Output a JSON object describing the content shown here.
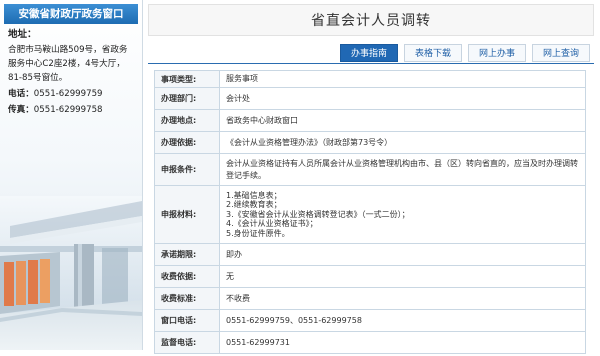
{
  "sidebar": {
    "header": "安徽省财政厅政务窗口",
    "address_label": "地址：",
    "address": "合肥市马鞍山路509号，省政务服务中心C2座2楼，4号大厅，81-85号窗位。",
    "phone_label": "电话：",
    "phone": "0551-62999759",
    "fax_label": "传真：",
    "fax": "0551-62999758"
  },
  "page_title": "省直会计人员调转",
  "tabs": [
    {
      "label": "办事指南",
      "active": true
    },
    {
      "label": "表格下载",
      "active": false
    },
    {
      "label": "网上办事",
      "active": false
    },
    {
      "label": "网上查询",
      "active": false
    }
  ],
  "rows": [
    {
      "key": "事项类型:",
      "value": "服务事项"
    },
    {
      "key": "办理部门:",
      "value": "会计处"
    },
    {
      "key": "办理地点:",
      "value": "省政务中心财政窗口"
    },
    {
      "key": "办理依据:",
      "value": "《会计从业资格管理办法》（财政部第73号令）"
    },
    {
      "key": "申报条件:",
      "value": "会计从业资格证持有人员所属会计从业资格管理机构由市、县（区）转向省直的，应当及时办理调转登记手续。"
    },
    {
      "key": "申报材料:",
      "value_lines": [
        "1.基础信息表；",
        "2.继续教育表；",
        "3.《安徽省会计从业资格调转登记表》（一式二份）；",
        "4.《会计从业资格证书》；",
        "5.身份证件原件。"
      ]
    },
    {
      "key": "承诺期限:",
      "value": "即办"
    },
    {
      "key": "收费依据:",
      "value": "无"
    },
    {
      "key": "收费标准:",
      "value": "不收费"
    },
    {
      "key": "窗口电话:",
      "value": "0551-62999759、0551-62999758"
    },
    {
      "key": "监督电话:",
      "value": "0551-62999731"
    }
  ],
  "colors": {
    "accent": "#2068b4",
    "header_gradient_top": "#3c8fd4"
  }
}
